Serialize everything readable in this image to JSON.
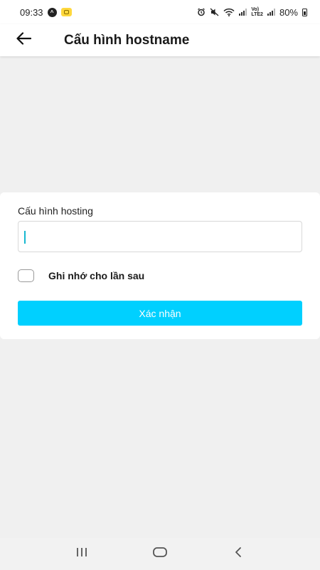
{
  "status_bar": {
    "time": "09:33",
    "battery_text": "80%",
    "network_label": "Vo)\nLTE2",
    "icons": [
      "notification-a-icon",
      "notification-b-icon",
      "alarm-icon",
      "mute-icon",
      "wifi-icon",
      "signal-icon",
      "signal-2-icon",
      "battery-icon"
    ]
  },
  "app_bar": {
    "title": "Cấu hình hostname",
    "back_icon": "arrow-left-icon"
  },
  "form": {
    "field_label": "Cấu hình hosting",
    "input_value": "",
    "remember_label": "Ghi nhớ cho lần sau",
    "remember_checked": false,
    "confirm_label": "Xác nhận"
  },
  "colors": {
    "accent": "#00d0ff",
    "background": "#f0f0f0",
    "card": "#ffffff"
  },
  "nav_bar": {
    "icons": [
      "recent-apps-icon",
      "home-icon",
      "back-icon"
    ]
  }
}
